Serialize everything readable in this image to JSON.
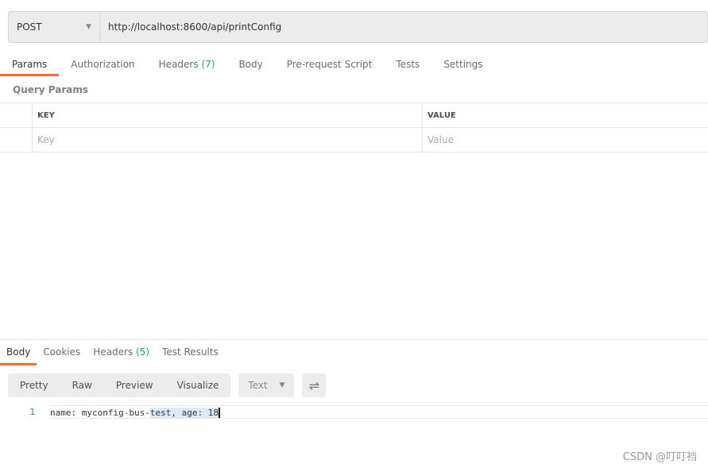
{
  "request": {
    "method": "POST",
    "url": "http://localhost:8600/api/printConfig"
  },
  "tabs": [
    {
      "label": "Params"
    },
    {
      "label": "Authorization"
    },
    {
      "label": "Headers",
      "count": "(7)"
    },
    {
      "label": "Body"
    },
    {
      "label": "Pre-request Script"
    },
    {
      "label": "Tests"
    },
    {
      "label": "Settings"
    }
  ],
  "query_params": {
    "title": "Query Params",
    "key_header": "KEY",
    "value_header": "VALUE",
    "key_placeholder": "Key",
    "value_placeholder": "Value"
  },
  "response": {
    "tabs": [
      {
        "label": "Body"
      },
      {
        "label": "Cookies"
      },
      {
        "label": "Headers",
        "count": "(5)"
      },
      {
        "label": "Test Results"
      }
    ],
    "views": [
      "Pretty",
      "Raw",
      "Preview",
      "Visualize"
    ],
    "format": "Text",
    "lines": [
      {
        "num": "1",
        "text_a": "name: myconfig-bus-",
        "text_b": "test, age: 18"
      }
    ]
  },
  "watermark": "CSDN @叮叮裆",
  "colors": {
    "accent": "#f26b3a",
    "count": "#26a556"
  }
}
